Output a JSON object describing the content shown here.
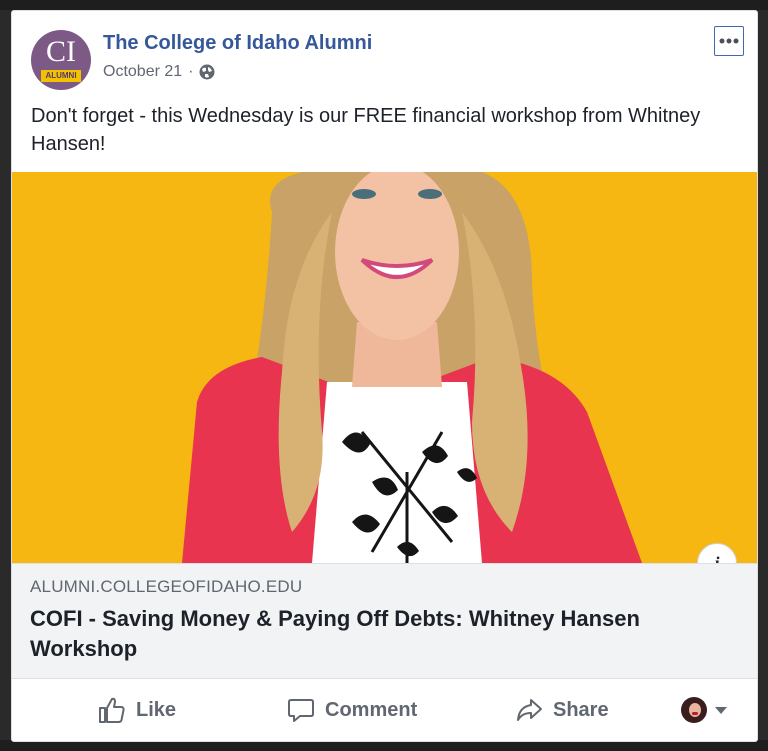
{
  "post": {
    "page_name": "The College of Idaho Alumni",
    "avatar": {
      "monogram": "CI",
      "tag": "ALUMNI"
    },
    "date": "October 21",
    "separator": "·",
    "privacy_icon": "globe-icon",
    "text": "Don't forget - this Wednesday is our FREE financial workshop from Whitney Hansen!"
  },
  "link": {
    "domain": "ALUMNI.COLLEGEOFIDAHO.EDU",
    "title": "COFI - Saving Money & Paying Off Debts: Whitney Hansen Workshop",
    "info_label": "i"
  },
  "actions": {
    "like_label": "Like",
    "comment_label": "Comment",
    "share_label": "Share"
  },
  "colors": {
    "page_name": "#365899",
    "photo_background": "#f6b713",
    "blazer": "#e8344e",
    "action_text": "#606770"
  }
}
